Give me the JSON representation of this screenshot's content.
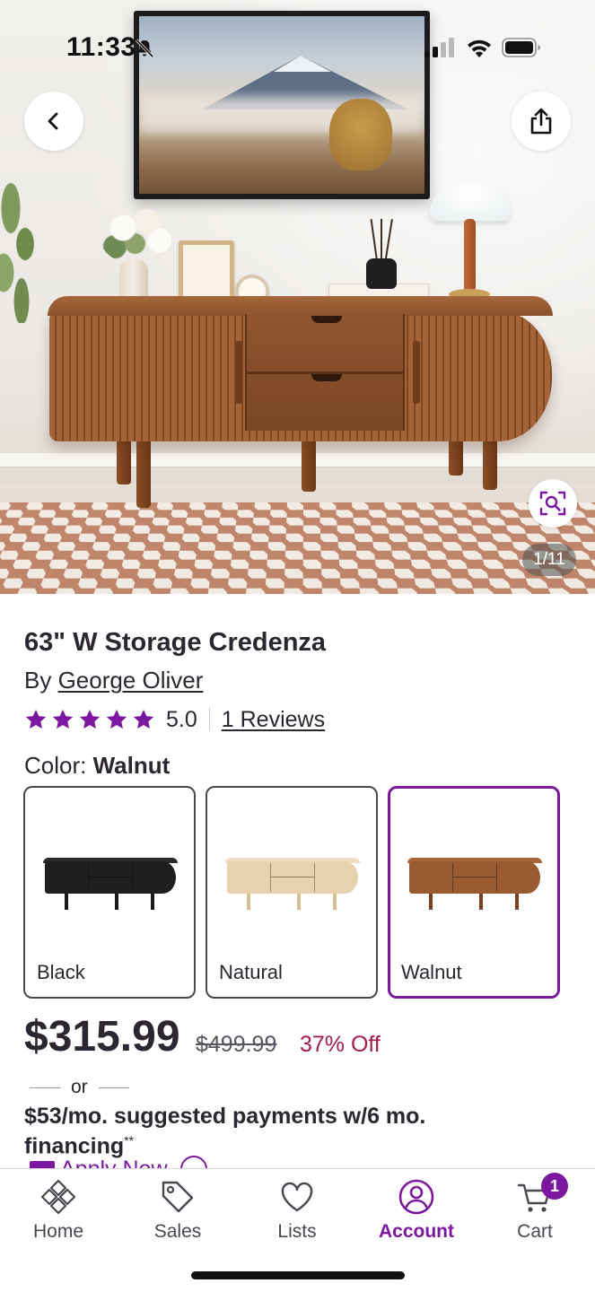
{
  "status_bar": {
    "time": "11:33"
  },
  "gallery": {
    "counter": "1/11"
  },
  "product": {
    "title": "63\" W Storage Credenza",
    "brand_prefix": "By ",
    "brand_name": "George Oliver",
    "rating_value": "5.0",
    "rating_stars": 5,
    "reviews_link": "1 Reviews"
  },
  "color": {
    "label": "Color: ",
    "selected": "Walnut",
    "options": [
      {
        "label": "Black",
        "body": "#1f1e21",
        "top": "#2a292c",
        "leg": "#1a1a1a"
      },
      {
        "label": "Natural",
        "body": "#e8d2ae",
        "top": "#eddcbf",
        "leg": "#d8bd92"
      },
      {
        "label": "Walnut",
        "body": "#9a5a32",
        "top": "#a8653a",
        "leg": "#7a4222"
      }
    ]
  },
  "pricing": {
    "price": "$315.99",
    "original_price": "$499.99",
    "discount": "37% Off",
    "or_text": "or",
    "financing_text": "$53/mo. suggested payments w/6 mo. financing",
    "financing_mark": "**",
    "apply_now": "Apply Now"
  },
  "tabs": [
    {
      "label": "Home",
      "icon": "home-diamond-icon"
    },
    {
      "label": "Sales",
      "icon": "tag-icon"
    },
    {
      "label": "Lists",
      "icon": "heart-icon"
    },
    {
      "label": "Account",
      "icon": "account-icon"
    },
    {
      "label": "Cart",
      "icon": "cart-icon",
      "badge": "1"
    }
  ],
  "colors": {
    "accent": "#7b189f",
    "discount": "#a11d4a",
    "text": "#2b2630"
  }
}
